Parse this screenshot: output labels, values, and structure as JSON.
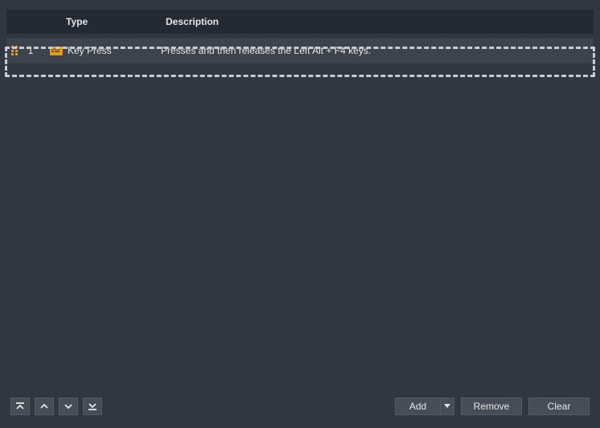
{
  "columns": {
    "type": "Type",
    "description": "Description"
  },
  "rows": [
    {
      "index": "1",
      "icon": "keyboard-icon",
      "type": "Key Press",
      "description": "Presses and then releases the Left Alt + F4 keys."
    }
  ],
  "footer": {
    "buttons": {
      "add": "Add",
      "remove": "Remove",
      "clear": "Clear"
    }
  }
}
